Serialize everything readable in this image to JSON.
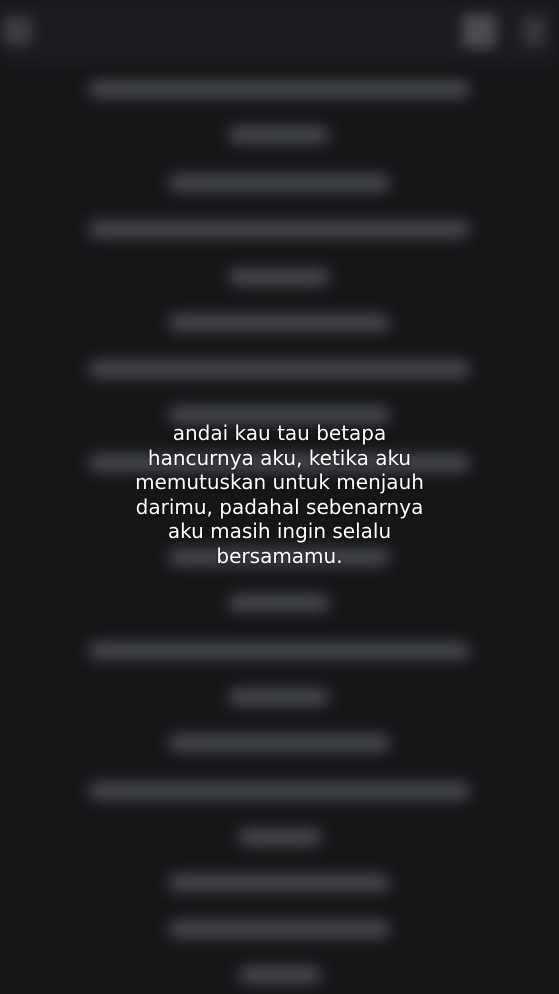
{
  "overlay": {
    "caption": "andai kau tau betapa\nhancurnya aku, ketika aku\nmemutuskan untuk menjauh\ndarimu, padahal sebenarnya\naku masih ingin selalu\nbersamamu."
  },
  "topbar": {
    "icons": [
      "menu-icon",
      "edit-icon",
      "more-options-icon"
    ]
  },
  "colors": {
    "background": "#151618",
    "topbar": "#1b1c1f",
    "blurred_text": "#45474b",
    "caption_text": "#ffffff"
  }
}
